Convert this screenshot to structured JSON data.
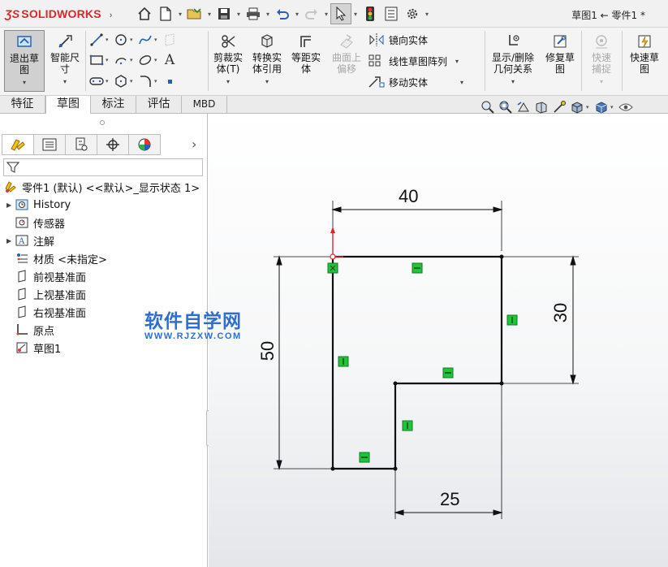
{
  "app": {
    "brand": "SOLIDWORKS",
    "document_title": "草图1 ← 零件1 *"
  },
  "ribbon": {
    "exit_sketch": "退出草图",
    "smart_dimension": "智能尺寸",
    "trim_entities": "剪裁实体(T)",
    "convert_entities": "转换实体引用",
    "offset_entities": "等距实体",
    "offset_on_surface": "曲面上偏移",
    "mirror_entities": "镜向实体",
    "linear_pattern": "线性草图阵列",
    "move_entities": "移动实体",
    "display_relations": "显示/删除几何关系",
    "repair_sketch": "修复草图",
    "quick_snaps": "快速捕捉",
    "rapid_sketch": "快速草图"
  },
  "tabs": [
    {
      "label": "特征"
    },
    {
      "label": "草图"
    },
    {
      "label": "标注"
    },
    {
      "label": "评估"
    },
    {
      "label": "MBD"
    }
  ],
  "tree": {
    "root": "零件1 (默认) <<默认>_显示状态 1>",
    "items": [
      {
        "label": "History"
      },
      {
        "label": "传感器"
      },
      {
        "label": "注解"
      },
      {
        "label": "材质 <未指定>"
      },
      {
        "label": "前视基准面"
      },
      {
        "label": "上视基准面"
      },
      {
        "label": "右视基准面"
      },
      {
        "label": "原点"
      },
      {
        "label": "草图1"
      }
    ]
  },
  "watermark": {
    "title": "软件自学网",
    "url": "WWW.RJZXW.COM"
  },
  "sketch": {
    "dimensions": {
      "top": "40",
      "right": "30",
      "left": "50",
      "bottom": "25"
    }
  }
}
